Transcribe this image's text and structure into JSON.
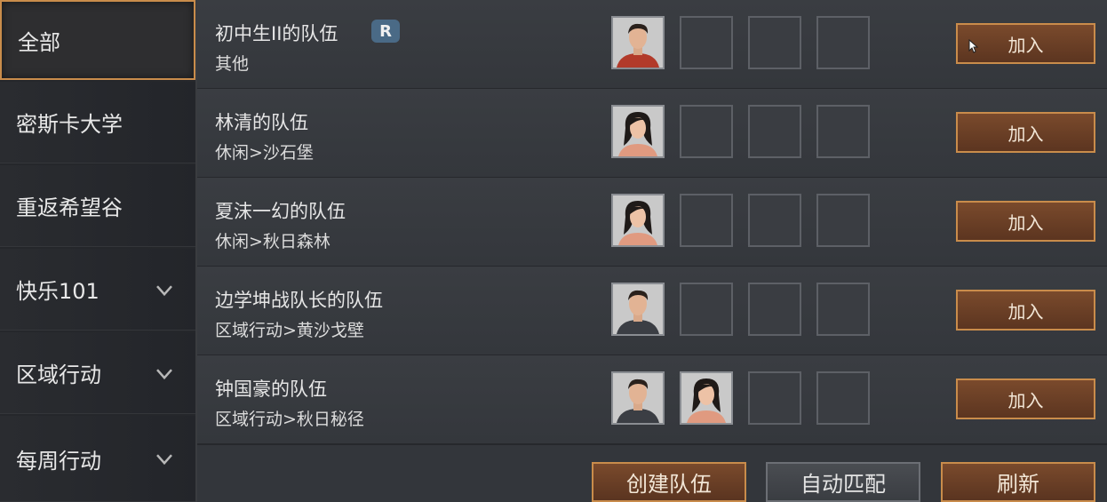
{
  "sidebar": {
    "items": [
      {
        "label": "全部",
        "active": true
      },
      {
        "label": "密斯卡大学"
      },
      {
        "label": "重返希望谷"
      },
      {
        "label": "快乐101",
        "expandable": true
      },
      {
        "label": "区域行动",
        "expandable": true
      },
      {
        "label": "每周行动",
        "expandable": true
      }
    ]
  },
  "teams": [
    {
      "name": "初中生II的队伍",
      "activity": "其他",
      "badge": "R",
      "members": [
        "male-brown-shirt"
      ],
      "join_label": "加入"
    },
    {
      "name": "林清的队伍",
      "activity": "休闲>沙石堡",
      "members": [
        "female"
      ],
      "join_label": "加入"
    },
    {
      "name": "夏沫一幻的队伍",
      "activity": "休闲>秋日森林",
      "members": [
        "female"
      ],
      "join_label": "加入"
    },
    {
      "name": "边学坤战队长的队伍",
      "activity": "区域行动>黄沙戈壁",
      "members": [
        "male-dark-shirt"
      ],
      "join_label": "加入"
    },
    {
      "name": "钟国豪的队伍",
      "activity": "区域行动>秋日秘径",
      "members": [
        "male-dark-shirt",
        "female"
      ],
      "join_label": "加入"
    }
  ],
  "footer": {
    "create_label": "创建队伍",
    "auto_match_label": "自动匹配",
    "refresh_label": "刷新"
  }
}
